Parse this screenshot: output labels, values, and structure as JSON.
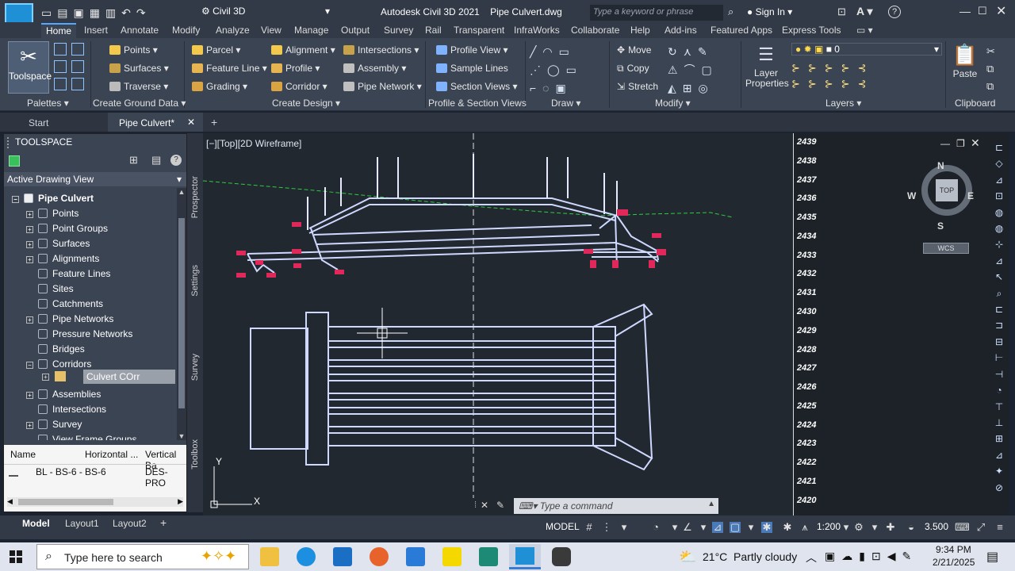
{
  "titlebar": {
    "app_logo": "C3D",
    "workspace": "Civil 3D",
    "title": "Autodesk Civil 3D 2021    Pipe Culvert.dwg",
    "search_placeholder": "Type a keyword or phrase",
    "sign_in": "Sign In"
  },
  "ribbon_tabs": [
    "Home",
    "Insert",
    "Annotate",
    "Modify",
    "Analyze",
    "View",
    "Manage",
    "Output",
    "Survey",
    "Rail",
    "Transparent",
    "InfraWorks",
    "Collaborate",
    "Help",
    "Add-ins",
    "Featured Apps",
    "Express Tools"
  ],
  "ribbon": {
    "toolspace": "Toolspace",
    "points": "Points",
    "surfaces": "Surfaces",
    "traverse": "Traverse",
    "parcel": "Parcel",
    "feature_line": "Feature Line",
    "grading": "Grading",
    "alignment": "Alignment",
    "profile": "Profile",
    "corridor": "Corridor",
    "intersections": "Intersections",
    "assembly": "Assembly",
    "pipe_network": "Pipe Network",
    "profile_view": "Profile View",
    "sample_lines": "Sample Lines",
    "section_views": "Section Views",
    "move": "Move",
    "copy": "Copy",
    "stretch": "Stretch",
    "layer_properties_1": "Layer",
    "layer_properties_2": "Properties",
    "layer_value": "0",
    "paste": "Paste",
    "panels": {
      "palettes": "Palettes",
      "create_ground": "Create Ground Data",
      "create_design": "Create Design",
      "profile_section": "Profile & Section Views",
      "draw": "Draw",
      "modify": "Modify",
      "layers": "Layers",
      "clipboard": "Clipboard"
    }
  },
  "doctabs": {
    "start": "Start",
    "active": "Pipe Culvert*"
  },
  "toolspace": {
    "title": "TOOLSPACE",
    "view_select": "Active Drawing View",
    "root": "Pipe Culvert",
    "items": [
      "Points",
      "Point Groups",
      "Surfaces",
      "Alignments",
      "Feature Lines",
      "Sites",
      "Catchments",
      "Pipe Networks",
      "Pressure Networks",
      "Bridges",
      "Corridors",
      "Culvert COrr",
      "Assemblies",
      "Intersections",
      "Survey",
      "View Frame Groups"
    ],
    "side_tabs": [
      "Prospector",
      "Settings",
      "Survey",
      "Toolbox"
    ],
    "table_headers": [
      "Name",
      "Horizontal ...",
      "Vertical Ba"
    ],
    "table_row": [
      "BL - BS-6 -",
      "BS-6",
      "DES-PRO"
    ]
  },
  "viewport": {
    "label": "[−][Top][2D Wireframe]",
    "elevations": [
      "2439",
      "2438",
      "2437",
      "2436",
      "2435",
      "2434",
      "2433",
      "2432",
      "2431",
      "2430",
      "2429",
      "2428",
      "2427",
      "2426",
      "2425",
      "2424",
      "2423",
      "2422",
      "2421",
      "2420"
    ],
    "compass": {
      "n": "N",
      "s": "S",
      "e": "E",
      "w": "W",
      "top": "TOP",
      "wcs": "WCS"
    },
    "ucs": {
      "x": "X",
      "y": "Y"
    },
    "command_placeholder": "Type a command"
  },
  "statusbar": {
    "tabs": [
      "Model",
      "Layout1",
      "Layout2"
    ],
    "model": "MODEL",
    "scale": "1:200",
    "value": "3.500"
  },
  "taskbar": {
    "search": "Type here to search",
    "weather": "21°C  Partly cloudy",
    "time": "9:34 PM",
    "date": "2/21/2025"
  },
  "colors": {
    "accent": "#55a7ff",
    "section_red": "#e0285a",
    "ground_green": "#2ecc40"
  }
}
